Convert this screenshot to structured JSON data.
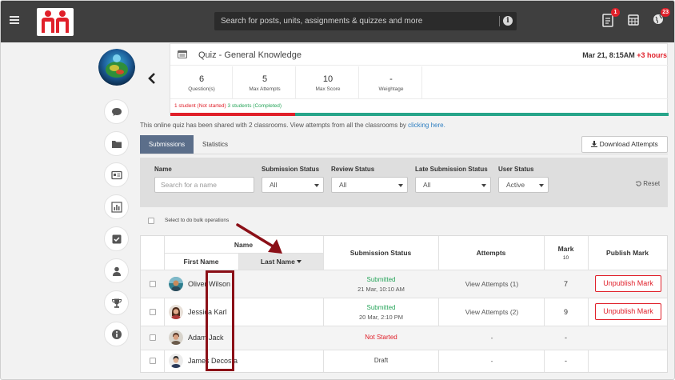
{
  "header": {
    "search_placeholder": "Search for posts, units, assignments & quizzes and more",
    "badge_notes": "1",
    "badge_notifications": "23"
  },
  "quiz": {
    "title": "Quiz - General Knowledge",
    "date": "Mar 21, 8:15AM",
    "extra": "+3 hours",
    "stats": [
      {
        "value": "6",
        "label": "Question(s)"
      },
      {
        "value": "5",
        "label": "Max Attempts"
      },
      {
        "value": "10",
        "label": "Max Score"
      },
      {
        "value": "-",
        "label": "Weightage"
      }
    ],
    "not_started_text": "1 student (Not started)",
    "completed_text": "3 students (Completed)",
    "progress": {
      "not_started": 1,
      "completed": 3
    }
  },
  "notice": {
    "text": "This online quiz has been shared with 2 classrooms. View attempts from all the classrooms by ",
    "link": "clicking here."
  },
  "tabs": {
    "submissions": "Submissions",
    "statistics": "Statistics"
  },
  "download_label": "Download Attempts",
  "filters": {
    "name_label": "Name",
    "name_placeholder": "Search for a name",
    "submission_status_label": "Submission Status",
    "submission_status_value": "All",
    "review_status_label": "Review Status",
    "review_status_value": "All",
    "late_label": "Late Submission Status",
    "late_value": "All",
    "user_status_label": "User Status",
    "user_status_value": "Active",
    "reset": "Reset"
  },
  "bulk_label": "Select to do bulk operations",
  "table": {
    "name_header": "Name",
    "first_name_header": "First Name",
    "last_name_header": "Last Name",
    "submission_status_header": "Submission Status",
    "attempts_header": "Attempts",
    "mark_header": "Mark",
    "mark_max": "10",
    "publish_header": "Publish Mark",
    "rows": [
      {
        "name": "Oliver Wilson",
        "status": "Submitted",
        "date": "21 Mar, 10:10 AM",
        "attempts": "View Attempts (1)",
        "mark": "7",
        "action": "Unpublish Mark"
      },
      {
        "name": "Jessica Karl",
        "status": "Submitted",
        "date": "20 Mar, 2:10 PM",
        "attempts": "View Attempts (2)",
        "mark": "9",
        "action": "Unpublish Mark"
      },
      {
        "name": "Adam Jack",
        "status": "Not Started",
        "date": "",
        "attempts": "-",
        "mark": "-",
        "action": ""
      },
      {
        "name": "James Decosta",
        "status": "Draft",
        "date": "",
        "attempts": "-",
        "mark": "-",
        "action": ""
      }
    ]
  },
  "colors": {
    "topbar": "#3f3f3f",
    "accent_red": "#e0202a",
    "accent_green": "#27a55a",
    "tab_active": "#5b6e8a",
    "highlight": "#8b0f17"
  }
}
